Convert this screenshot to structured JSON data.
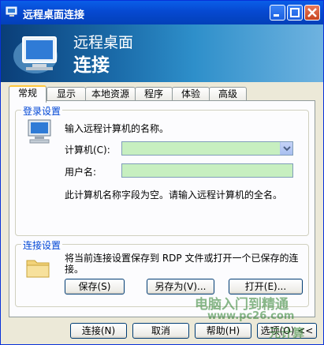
{
  "window": {
    "title": "远程桌面连接"
  },
  "banner": {
    "line1": "远程桌面",
    "line2": "连接"
  },
  "tabs": [
    "常规",
    "显示",
    "本地资源",
    "程序",
    "体验",
    "高级"
  ],
  "login": {
    "legend": "登录设置",
    "instruction": "输入远程计算机的名称。",
    "computer_label": "计算机(C):",
    "computer_value": "",
    "username_label": "用户名:",
    "username_value": "",
    "hint": "此计算机名称字段为空。请输入远程计算机的全名。"
  },
  "connection": {
    "legend": "连接设置",
    "description": "将当前连接设置保存到 RDP 文件或打开一个已保存的连接。",
    "save": "保存(S)",
    "save_as": "另存为(V)...",
    "open": "打开(E)..."
  },
  "footer": {
    "connect": "连接(N)",
    "cancel": "取消",
    "help": "帮助(H)",
    "options": "选项(O) <<"
  },
  "watermark": {
    "line1": "电脑入门到精通",
    "line2": "www.pc26.com",
    "line3": "元计算"
  }
}
